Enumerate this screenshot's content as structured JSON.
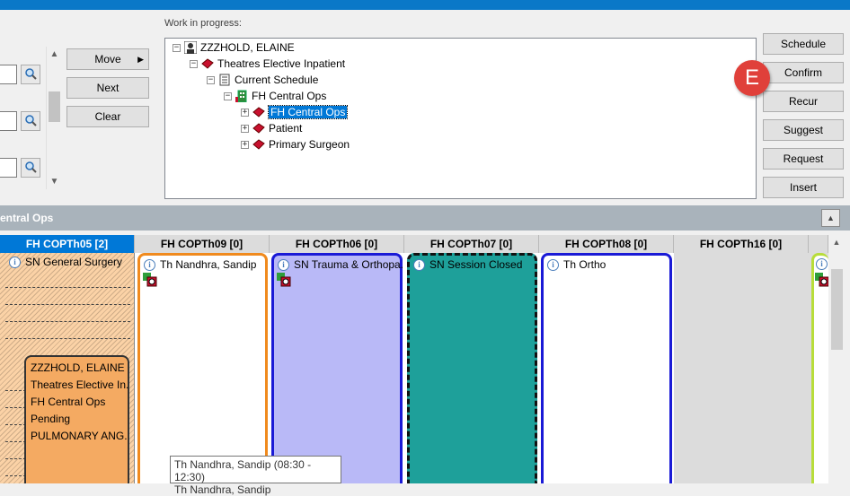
{
  "criteria": {
    "move_label": "Move",
    "next_label": "Next",
    "clear_label": "Clear"
  },
  "wip": {
    "label": "Work in progress:",
    "tree": [
      {
        "label": "ZZZHOLD, ELAINE",
        "icon": "patient-icon"
      },
      {
        "label": "Theatres Elective Inpatient",
        "icon": "book-icon"
      },
      {
        "label": "Current Schedule",
        "icon": "schedule-icon"
      },
      {
        "label": "FH Central Ops",
        "icon": "building-icon"
      },
      {
        "label": "FH Central Ops",
        "icon": "book-icon",
        "selected": true
      },
      {
        "label": "Patient",
        "icon": "book-icon"
      },
      {
        "label": "Primary Surgeon",
        "icon": "book-icon"
      }
    ]
  },
  "actions": {
    "schedule": "Schedule",
    "confirm": "Confirm",
    "recur": "Recur",
    "suggest": "Suggest",
    "request": "Request",
    "insert": "Insert"
  },
  "badge": "E",
  "section": {
    "title": "entral Ops"
  },
  "columns": [
    "FH COPTh05 [2]",
    "FH COPTh09 [0]",
    "FH COPTh06 [0]",
    "FH COPTh07 [0]",
    "FH COPTh08 [0]",
    "FH COPTh16 [0]"
  ],
  "sessions": {
    "c1": "SN General Surgery",
    "c2": "Th Nandhra, Sandip",
    "c3": "SN Trauma & Orthopa...",
    "c4": "SN Session Closed",
    "c5": "Th Ortho"
  },
  "appointment": {
    "lines": [
      "ZZZHOLD, ELAINE",
      "Theatres Elective In...",
      "FH Central Ops",
      "Pending",
      "PULMONARY ANG..."
    ]
  },
  "tooltip": {
    "line1": "Th Nandhra, Sandip (08:30 - 12:30)",
    "line2": "Th Nandhra, Sandip"
  },
  "colors": {
    "accent": "#0078d7",
    "badge": "#e0403a",
    "col1_bg": "#fbd2a6",
    "appt_bg": "#f4aa62",
    "col3_bg": "#b9b9f7",
    "col4_bg": "#1ea09a",
    "col2_border": "#f08a1e",
    "col6_border": "#b8dd3a"
  }
}
